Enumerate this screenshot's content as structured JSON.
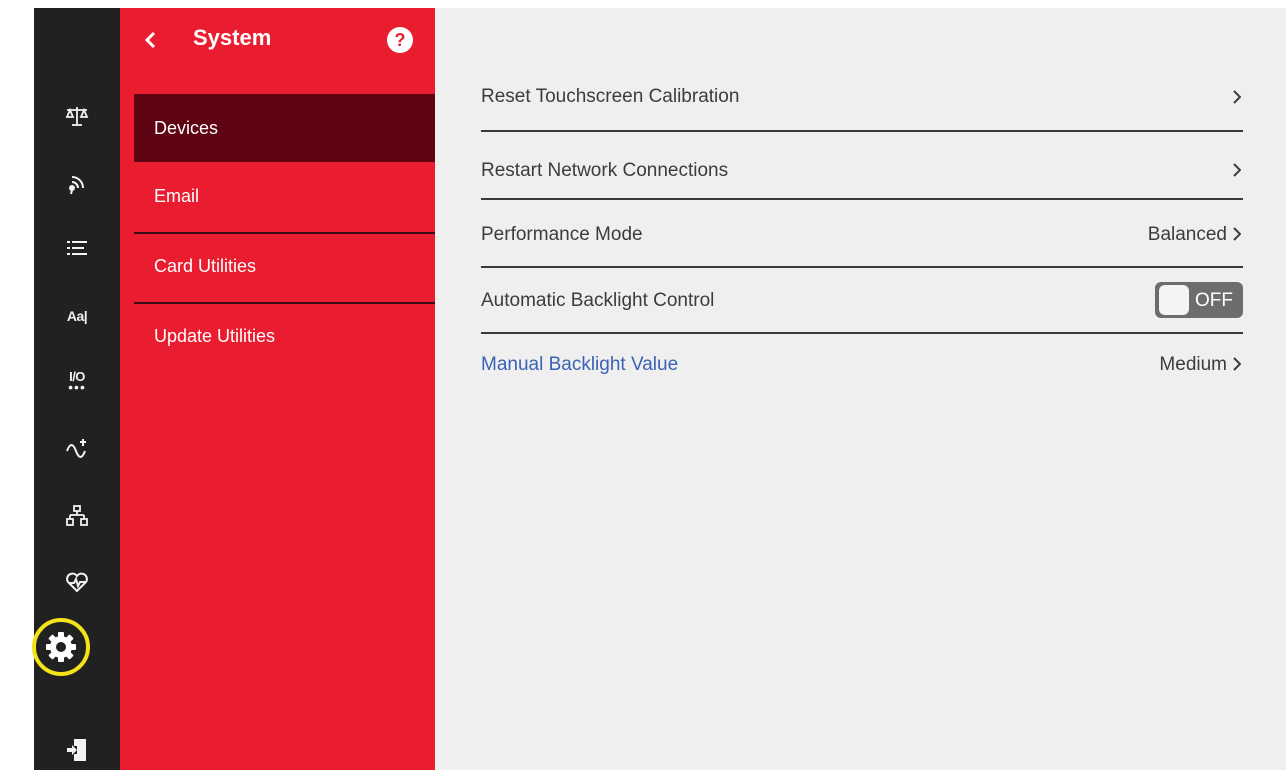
{
  "colors": {
    "icon_bar_bg": "#212121",
    "submenu_bg": "#ea1c2f",
    "submenu_active_bg": "#5e0413",
    "content_bg": "#f0eff0",
    "highlight_ring": "#f5e31a",
    "link_text": "#3a62b3"
  },
  "nav_icons": [
    {
      "name": "scale-icon"
    },
    {
      "name": "wireless-signal-icon"
    },
    {
      "name": "list-icon"
    },
    {
      "name": "text-format-icon",
      "text": "Aa|"
    },
    {
      "name": "io-icon",
      "text": "I/O"
    },
    {
      "name": "signal-wave-icon"
    },
    {
      "name": "network-hierarchy-icon"
    },
    {
      "name": "health-heart-icon"
    },
    {
      "name": "gear-icon",
      "selected": true
    },
    {
      "name": "logout-door-icon"
    }
  ],
  "submenu": {
    "title": "System",
    "back_icon": "chevron-left-icon",
    "help_icon": "question-icon",
    "help_text": "?",
    "items": [
      {
        "label": "Devices",
        "active": true
      },
      {
        "label": "Email",
        "active": false
      },
      {
        "label": "Card Utilities",
        "active": false
      },
      {
        "label": "Update Utilities",
        "active": false
      }
    ]
  },
  "settings": [
    {
      "label": "Reset Touchscreen Calibration",
      "value": ""
    },
    {
      "label": "Restart Network Connections",
      "value": ""
    },
    {
      "label": "Performance Mode",
      "value": "Balanced"
    },
    {
      "label": "Automatic Backlight Control",
      "toggle_state": "OFF",
      "enabled": false
    },
    {
      "label": "Manual Backlight Value",
      "value": "Medium"
    }
  ]
}
